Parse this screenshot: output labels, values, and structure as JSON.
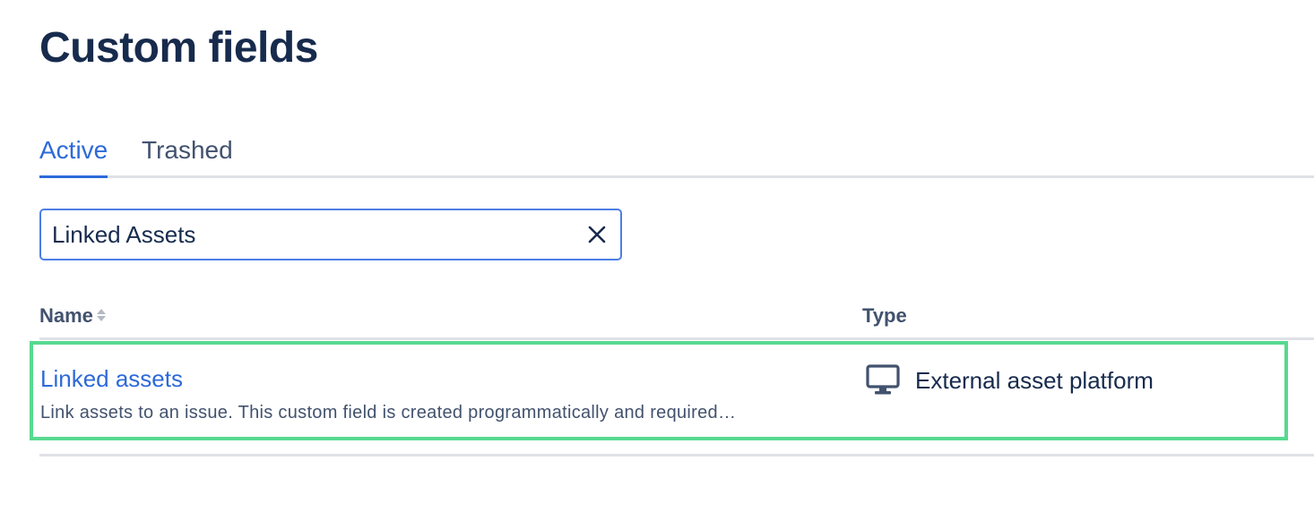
{
  "page": {
    "title": "Custom fields"
  },
  "tabs": [
    {
      "label": "Active",
      "active": true
    },
    {
      "label": "Trashed",
      "active": false
    }
  ],
  "search": {
    "value": "Linked Assets",
    "clear_icon": "close-icon"
  },
  "table": {
    "columns": [
      {
        "label": "Name",
        "sortable": true,
        "sort_icon": "sort-icon"
      },
      {
        "label": "Type",
        "sortable": false
      }
    ],
    "rows": [
      {
        "name": "Linked assets",
        "description": "Link assets to an issue. This custom field is created programmatically and required…",
        "type": "External asset platform",
        "type_icon": "monitor-icon",
        "highlighted": true
      }
    ]
  },
  "colors": {
    "accent": "#2d6ad8",
    "highlight_border": "#57d98f",
    "text_primary": "#172b4d",
    "text_secondary": "#42526e",
    "divider": "#dfe1e6"
  }
}
